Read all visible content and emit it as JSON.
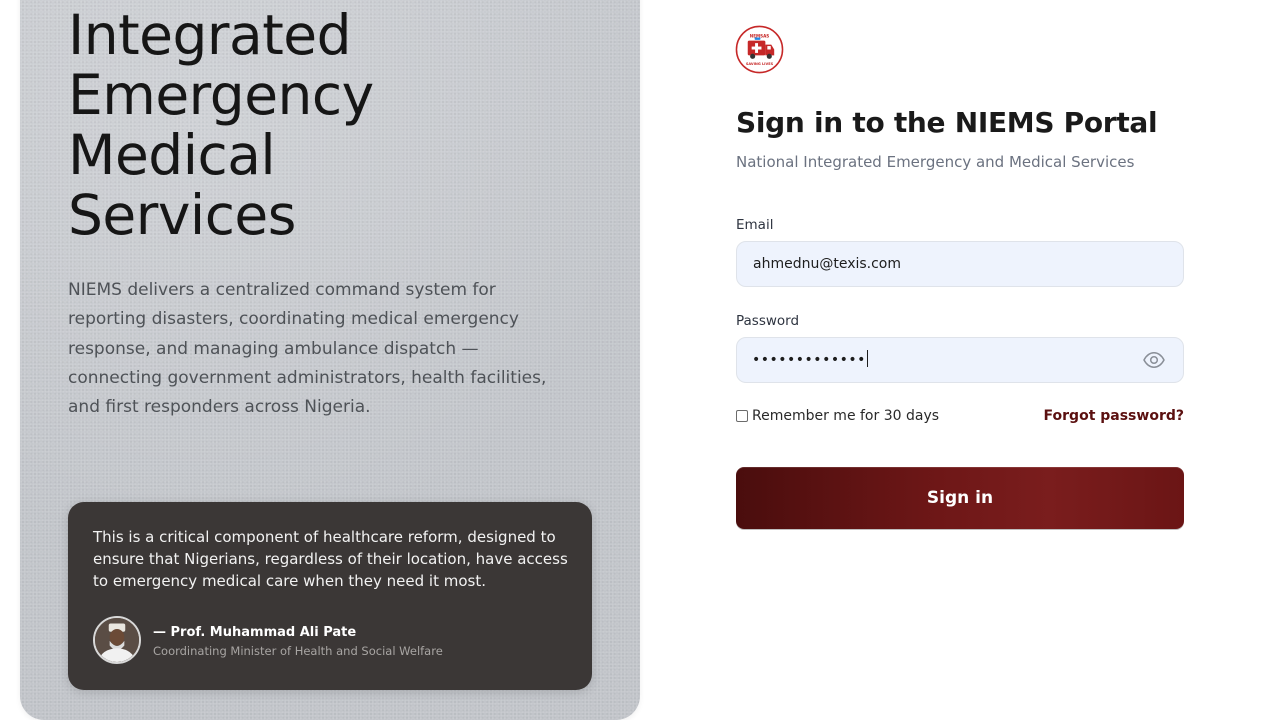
{
  "hero": {
    "title_lines": [
      "Integrated",
      "Emergency",
      "Medical",
      "Services"
    ],
    "description": "NIEMS delivers a centralized command system for reporting disasters, coordinating medical emergency response, and managing ambulance dispatch — connecting government administrators, health facilities, and first responders across Nigeria.",
    "quote": {
      "text": "This is a critical component of healthcare reform, designed to ensure that Nigerians, regardless of their location, have access to emergency medical care when they need it most.",
      "author": "— Prof. Muhammad Ali Pate",
      "role": "Coordinating Minister of Health and Social Welfare"
    }
  },
  "logo": {
    "top_text": "NEMSAS",
    "bottom_text": "SAVING LIVES"
  },
  "form": {
    "title": "Sign in to the NIEMS Portal",
    "subtitle": "National Integrated Emergency and Medical Services",
    "email_label": "Email",
    "email_value": "ahmednu@texis.com",
    "password_label": "Password",
    "password_masked": "•••••••••••••",
    "remember_label": "Remember me for 30 days",
    "remember_checked": false,
    "forgot_label": "Forgot password?",
    "submit_label": "Sign in"
  },
  "colors": {
    "brand_dark": "#4a0d0d",
    "brand": "#7a1d1d",
    "link": "#5b1010",
    "input_bg": "#eef3fd"
  },
  "icons": {
    "password_toggle": "eye-icon",
    "logo": "ambulance-icon"
  }
}
